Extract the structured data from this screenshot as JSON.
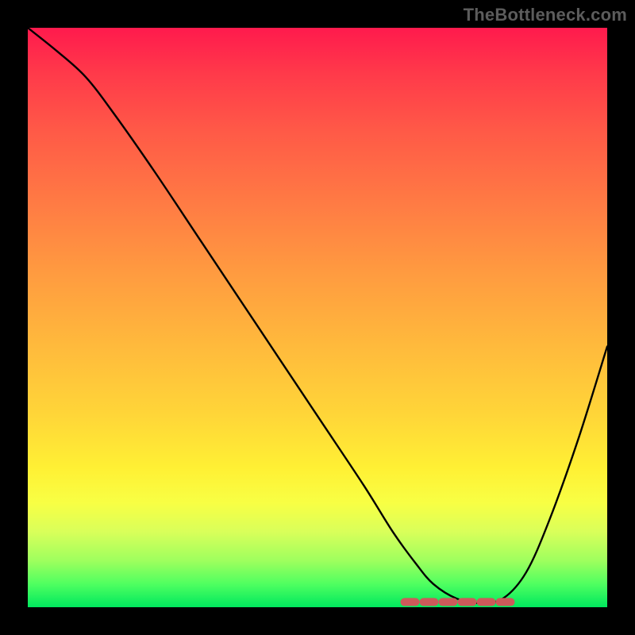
{
  "watermark": "TheBottleneck.com",
  "colors": {
    "frame": "#000000",
    "watermark": "#5c5c5c",
    "curve": "#000000",
    "optimal_marker": "#cc5a5a"
  },
  "chart_data": {
    "type": "line",
    "title": "",
    "xlabel": "",
    "ylabel": "",
    "xlim": [
      0,
      100
    ],
    "ylim": [
      0,
      100
    ],
    "grid": false,
    "series": [
      {
        "name": "bottleneck-curve",
        "x": [
          0,
          5,
          10,
          15,
          22,
          30,
          40,
          50,
          58,
          63,
          67,
          70,
          74,
          78,
          82,
          86,
          90,
          95,
          100
        ],
        "y": [
          100,
          96,
          91.5,
          85,
          75,
          63,
          48,
          33,
          21,
          13,
          7.5,
          4,
          1.5,
          0.7,
          1.5,
          6,
          15,
          29,
          45
        ]
      }
    ],
    "optimal_zone": {
      "x_start": 65,
      "x_end": 84,
      "y": 0.9
    },
    "gradient_stops": [
      {
        "pct": 0,
        "color": "#ff1a4d"
      },
      {
        "pct": 8,
        "color": "#ff3a4a"
      },
      {
        "pct": 18,
        "color": "#ff5a47"
      },
      {
        "pct": 30,
        "color": "#ff7a44"
      },
      {
        "pct": 42,
        "color": "#ff9a40"
      },
      {
        "pct": 55,
        "color": "#ffba3c"
      },
      {
        "pct": 67,
        "color": "#ffd638"
      },
      {
        "pct": 76,
        "color": "#fff034"
      },
      {
        "pct": 82,
        "color": "#f8ff44"
      },
      {
        "pct": 87,
        "color": "#d9ff5a"
      },
      {
        "pct": 92,
        "color": "#9eff5e"
      },
      {
        "pct": 96,
        "color": "#4fff60"
      },
      {
        "pct": 100,
        "color": "#00e85e"
      }
    ]
  }
}
